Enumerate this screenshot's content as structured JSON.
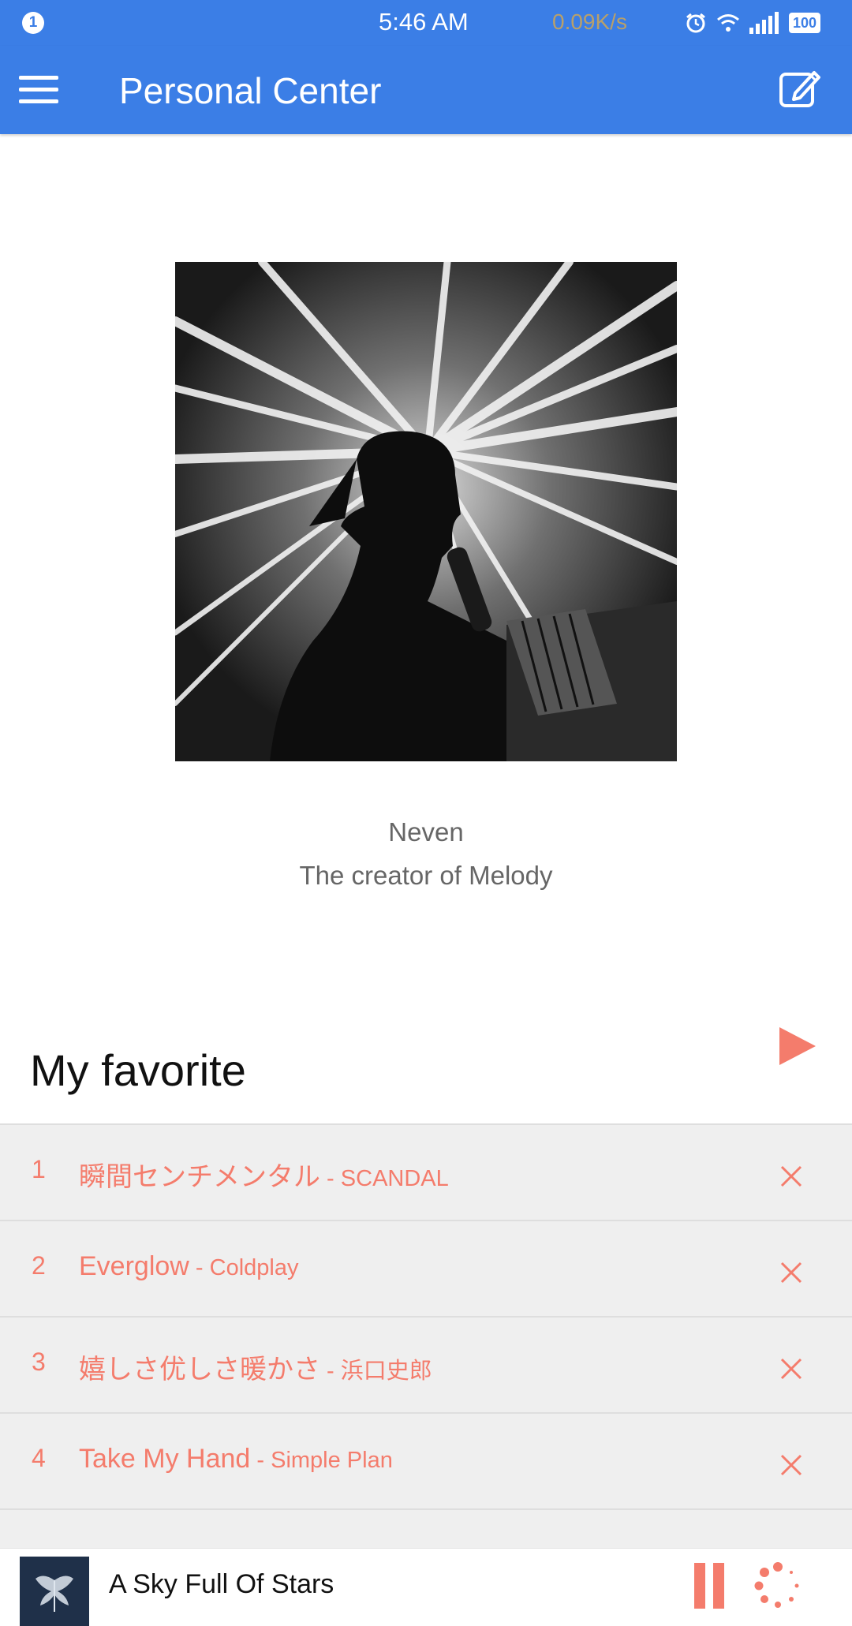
{
  "status_bar": {
    "notification_count": "1",
    "time": "5:46 AM",
    "net_speed": "0.09K/s",
    "battery": "100"
  },
  "app_bar": {
    "title": "Personal Center",
    "menu_icon": "hamburger-menu-icon",
    "edit_icon": "edit-icon"
  },
  "profile": {
    "name": "Neven",
    "description": "The creator of Melody"
  },
  "favorites": {
    "title": "My favorite",
    "play_icon": "play-icon",
    "songs": [
      {
        "number": "1",
        "title": "瞬間センチメンタル",
        "separator": " - ",
        "artist": "SCANDAL"
      },
      {
        "number": "2",
        "title": "Everglow",
        "separator": " - ",
        "artist": "Coldplay"
      },
      {
        "number": "3",
        "title": "嬉しさ优しさ暖かさ",
        "separator": " - ",
        "artist": "浜口史郎"
      },
      {
        "number": "4",
        "title": "Take My Hand",
        "separator": " - ",
        "artist": "Simple Plan"
      }
    ]
  },
  "player": {
    "now_playing": "A Sky Full Of Stars",
    "pause_icon": "pause-icon",
    "loading_icon": "loading-spinner-icon"
  },
  "colors": {
    "primary": "#3b7ee6",
    "accent": "#f47c6c",
    "list_bg": "#efefef"
  }
}
